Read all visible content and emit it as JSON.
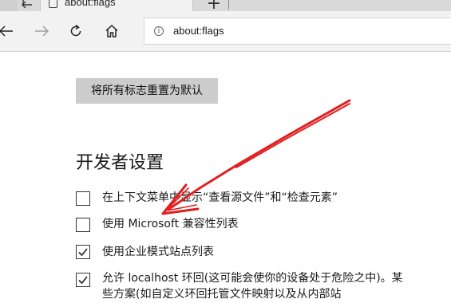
{
  "tabstrip": {
    "tab_title": "about:flags",
    "new_tab_glyph": "+"
  },
  "toolbar": {
    "address_value": "about:flags",
    "info_glyph": "i"
  },
  "content": {
    "reset_label": "将所有标志重置为默认",
    "section_title": "开发者设置",
    "options": [
      {
        "label": "在上下文菜单中显示“查看源文件”和“检查元素”",
        "checked": false
      },
      {
        "label": "使用 Microsoft 兼容性列表",
        "checked": false
      },
      {
        "label": "使用企业模式站点列表",
        "checked": true
      },
      {
        "label": "允许 localhost 环回(这可能会使你的设备处于危险之中)。某些方案(如自定义环回托管文件映射以及从内部站",
        "checked": true
      }
    ]
  },
  "annotation": {
    "arrow_color": "#e02020"
  }
}
